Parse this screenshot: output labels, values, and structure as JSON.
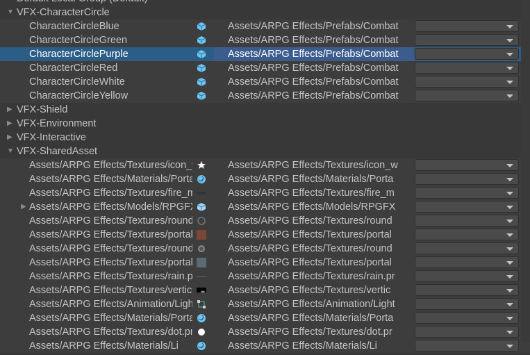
{
  "default_group": "Default Local Group (Default)",
  "groups": [
    {
      "name": "VFX-CharacterCircle",
      "expanded": true
    },
    {
      "name": "VFX-Shield",
      "expanded": false
    },
    {
      "name": "VFX-Environment",
      "expanded": false
    },
    {
      "name": "VFX-Interactive",
      "expanded": false
    },
    {
      "name": "VFX-SharedAsset",
      "expanded": true
    }
  ],
  "character_entries": [
    {
      "name": "CharacterCircleBlue",
      "path": "Assets/ARPG Effects/Prefabs/Combat",
      "icon": "prefab-icon"
    },
    {
      "name": "CharacterCircleGreen",
      "path": "Assets/ARPG Effects/Prefabs/Combat",
      "icon": "prefab-icon"
    },
    {
      "name": "CharacterCirclePurple",
      "path": "Assets/ARPG Effects/Prefabs/Combat",
      "icon": "prefab-icon",
      "selected": true
    },
    {
      "name": "CharacterCircleRed",
      "path": "Assets/ARPG Effects/Prefabs/Combat",
      "icon": "prefab-icon"
    },
    {
      "name": "CharacterCircleWhite",
      "path": "Assets/ARPG Effects/Prefabs/Combat",
      "icon": "prefab-icon"
    },
    {
      "name": "CharacterCircleYellow",
      "path": "Assets/ARPG Effects/Prefabs/Combat",
      "icon": "prefab-icon"
    }
  ],
  "shared_entries": [
    {
      "name": "Assets/ARPG Effects/Textures/icon_w",
      "path": "Assets/ARPG Effects/Textures/icon_w",
      "icon": "star-icon"
    },
    {
      "name": "Assets/ARPG Effects/Materials/Porta",
      "path": "Assets/ARPG Effects/Materials/Porta",
      "icon": "material-icon"
    },
    {
      "name": "Assets/ARPG Effects/Textures/fire_m",
      "path": "Assets/ARPG Effects/Textures/fire_m",
      "icon": "dark-texture-icon"
    },
    {
      "name": "Assets/ARPG Effects/Models/RPGFX",
      "path": "Assets/ARPG Effects/Models/RPGFX",
      "icon": "model-icon",
      "has_children": true
    },
    {
      "name": "Assets/ARPG Effects/Textures/round",
      "path": "Assets/ARPG Effects/Textures/round",
      "icon": "ring-texture-icon"
    },
    {
      "name": "Assets/ARPG Effects/Textures/portal",
      "path": "Assets/ARPG Effects/Textures/portal",
      "icon": "brown-texture-icon"
    },
    {
      "name": "Assets/ARPG Effects/Textures/round",
      "path": "Assets/ARPG Effects/Textures/round",
      "icon": "grey-circle-texture-icon"
    },
    {
      "name": "Assets/ARPG Effects/Textures/portal",
      "path": "Assets/ARPG Effects/Textures/portal",
      "icon": "slate-texture-icon"
    },
    {
      "name": "Assets/ARPG Effects/Textures/rain.pr",
      "path": "Assets/ARPG Effects/Textures/rain.pr",
      "icon": "line-texture-icon"
    },
    {
      "name": "Assets/ARPG Effects/Textures/vertic",
      "path": "Assets/ARPG Effects/Textures/vertic",
      "icon": "gradient-texture-icon"
    },
    {
      "name": "Assets/ARPG Effects/Animation/Light",
      "path": "Assets/ARPG Effects/Animation/Light",
      "icon": "animator-icon"
    },
    {
      "name": "Assets/ARPG Effects/Materials/Porta",
      "path": "Assets/ARPG Effects/Materials/Porta",
      "icon": "material-icon"
    },
    {
      "name": "Assets/ARPG Effects/Textures/dot.pr",
      "path": "Assets/ARPG Effects/Textures/dot.pr",
      "icon": "dot-texture-icon"
    },
    {
      "name": "Assets/ARPG Effects/Materials/Li",
      "path": "Assets/ARPG Effects/Materials/Li",
      "icon": "material-icon"
    }
  ],
  "colors": {
    "selection": "#2c5d87",
    "prefab": "#6cc4f2"
  }
}
